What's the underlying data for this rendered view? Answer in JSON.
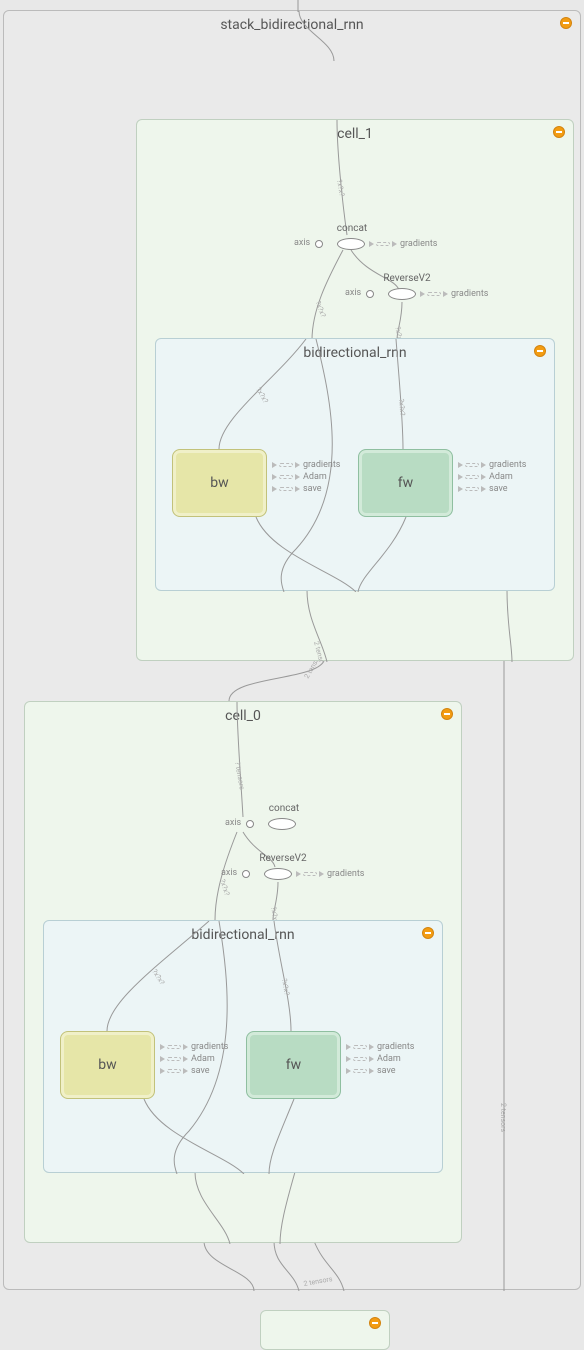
{
  "outer_scope": {
    "title": "stack_bidirectional_rnn"
  },
  "cell_1": {
    "title": "cell_1",
    "concat": {
      "label": "concat",
      "axis_label": "axis",
      "out": [
        "gradients"
      ]
    },
    "reverse": {
      "label": "ReverseV2",
      "axis_label": "axis",
      "out": [
        "gradients"
      ]
    },
    "birnn": {
      "title": "bidirectional_rnn",
      "bw": {
        "label": "bw",
        "out": [
          "gradients",
          "Adam",
          "save"
        ]
      },
      "fw": {
        "label": "fw",
        "out": [
          "gradients",
          "Adam",
          "save"
        ]
      }
    }
  },
  "cell_0": {
    "title": "cell_0",
    "concat": {
      "label": "concat",
      "axis_label": "axis",
      "out": []
    },
    "reverse": {
      "label": "ReverseV2",
      "axis_label": "axis",
      "out": [
        "gradients"
      ]
    },
    "birnn": {
      "title": "bidirectional_rnn",
      "bw": {
        "label": "bw",
        "out": [
          "gradients",
          "Adam",
          "save"
        ]
      },
      "fw": {
        "label": "fw",
        "out": [
          "gradients",
          "Adam",
          "save"
        ]
      }
    }
  },
  "bottom_scope_visible": true
}
